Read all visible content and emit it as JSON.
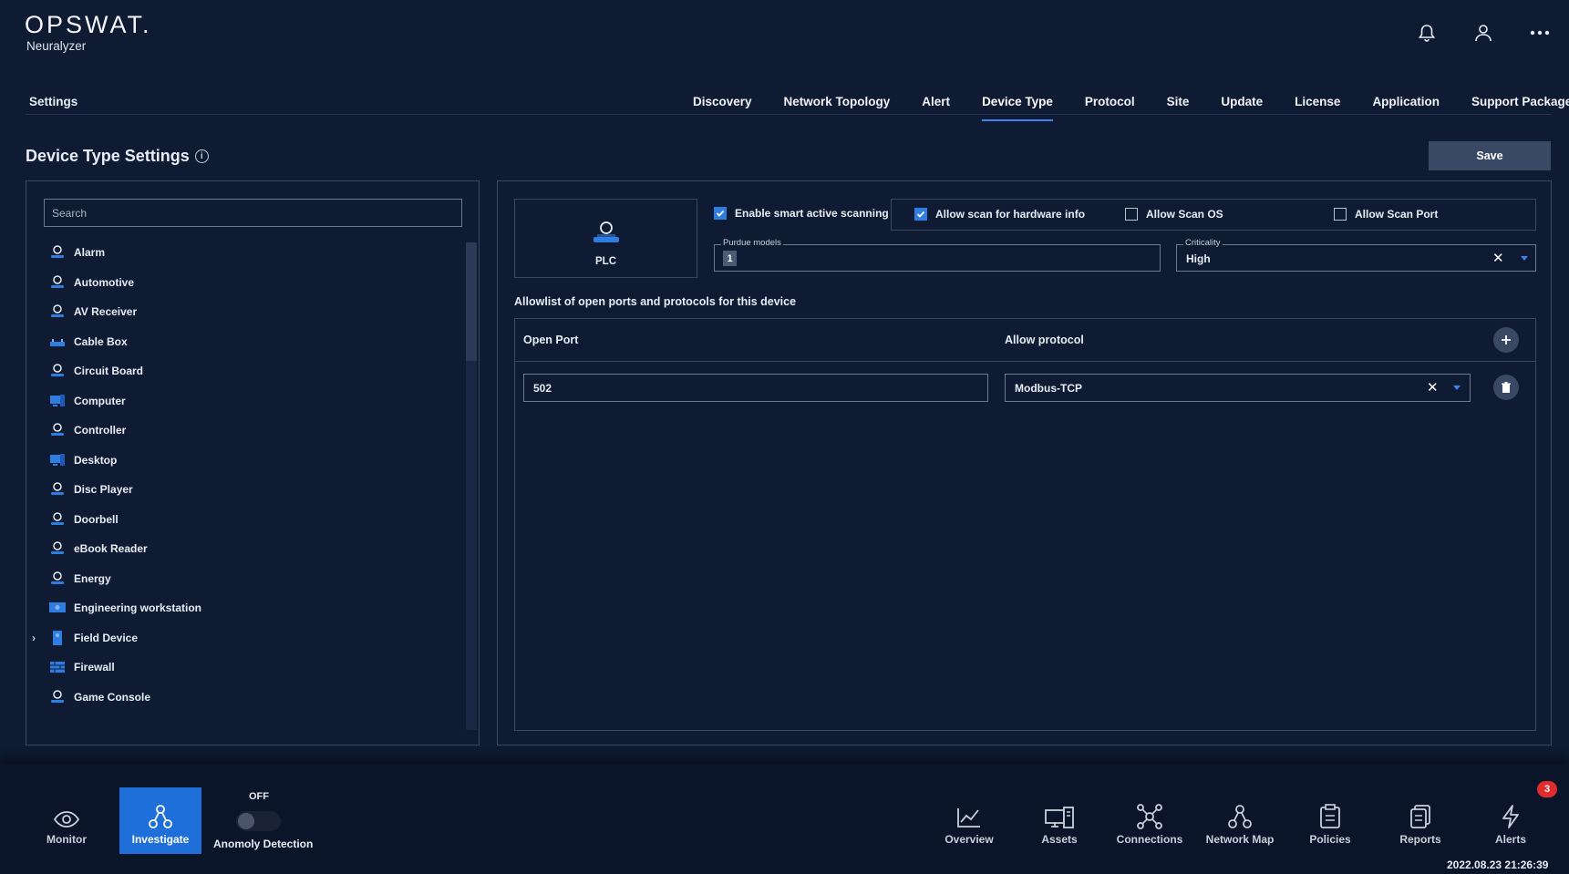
{
  "brand": {
    "logo": "OPSWAT.",
    "product": "Neuralyzer"
  },
  "header": {
    "icons": [
      "bell-icon",
      "user-icon",
      "more-icon"
    ]
  },
  "nav": {
    "settings_label": "Settings",
    "tabs": [
      {
        "label": "Discovery"
      },
      {
        "label": "Network Topology"
      },
      {
        "label": "Alert"
      },
      {
        "label": "Device Type",
        "active": true
      },
      {
        "label": "Protocol"
      },
      {
        "label": "Site"
      },
      {
        "label": "Update"
      },
      {
        "label": "License"
      },
      {
        "label": "Application"
      },
      {
        "label": "Support Package"
      }
    ]
  },
  "page": {
    "title": "Device Type Settings",
    "save_label": "Save"
  },
  "device_list": {
    "search_placeholder": "Search",
    "items": [
      {
        "label": "Alarm",
        "icon": "generic"
      },
      {
        "label": "Automotive",
        "icon": "generic"
      },
      {
        "label": "AV Receiver",
        "icon": "generic"
      },
      {
        "label": "Cable Box",
        "icon": "cablebox"
      },
      {
        "label": "Circuit Board",
        "icon": "generic"
      },
      {
        "label": "Computer",
        "icon": "computer"
      },
      {
        "label": "Controller",
        "icon": "generic"
      },
      {
        "label": "Desktop",
        "icon": "computer"
      },
      {
        "label": "Disc Player",
        "icon": "generic"
      },
      {
        "label": "Doorbell",
        "icon": "generic"
      },
      {
        "label": "eBook Reader",
        "icon": "generic"
      },
      {
        "label": "Energy",
        "icon": "generic"
      },
      {
        "label": "Engineering workstation",
        "icon": "workstation"
      },
      {
        "label": "Field Device",
        "icon": "field",
        "expandable": true
      },
      {
        "label": "Firewall",
        "icon": "firewall"
      },
      {
        "label": "Game Console",
        "icon": "generic"
      }
    ]
  },
  "detail": {
    "device_name": "PLC",
    "enable_smart_scanning": {
      "label": "Enable smart active scanning",
      "checked": true
    },
    "scan_options": [
      {
        "label": "Allow scan for hardware info",
        "checked": true
      },
      {
        "label": "Allow Scan OS",
        "checked": false
      },
      {
        "label": "Allow Scan Port",
        "checked": false
      }
    ],
    "purdue": {
      "legend": "Purdue models",
      "value": "1"
    },
    "criticality": {
      "legend": "Criticality",
      "value": "High"
    },
    "allowlist_title": "Allowlist of open ports and protocols for this device",
    "table": {
      "col_port": "Open Port",
      "col_protocol": "Allow protocol",
      "rows": [
        {
          "port": "502",
          "protocol": "Modbus-TCP"
        }
      ]
    }
  },
  "bottom": {
    "monitor": "Monitor",
    "investigate": "Investigate",
    "anomaly_state": "OFF",
    "anomaly_label": "Anomoly Detection",
    "items": [
      {
        "label": "Overview"
      },
      {
        "label": "Assets"
      },
      {
        "label": "Connections"
      },
      {
        "label": "Network Map"
      },
      {
        "label": "Policies"
      },
      {
        "label": "Reports"
      },
      {
        "label": "Alerts"
      }
    ],
    "alerts_badge": "3",
    "timestamp": "2022.08.23 21:26:39"
  },
  "colors": {
    "background": "#0f1b33",
    "accent": "#2f7de1",
    "badge": "#e02c2c",
    "bottom_bar": "#0b1529"
  }
}
